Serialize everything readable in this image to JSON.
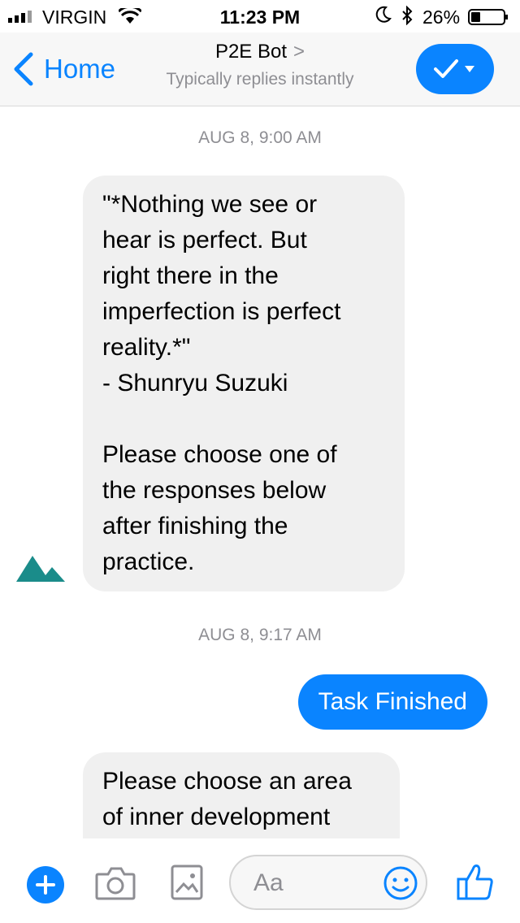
{
  "status_bar": {
    "carrier": "VIRGIN",
    "time": "11:23 PM",
    "battery": "26%"
  },
  "header": {
    "back_label": "Home",
    "title": "P2E Bot",
    "chevron": ">",
    "subtitle": "Typically replies instantly"
  },
  "messages": {
    "timestamp_1": "AUG 8, 9:00 AM",
    "bot_message_1_lines": [
      "\"*Nothing we see or",
      "hear is perfect. But",
      "right there in the",
      "imperfection is perfect",
      "reality.*\"",
      "- Shunryu Suzuki",
      "",
      "Please choose one of",
      "the responses below",
      "after finishing the",
      "practice."
    ],
    "timestamp_2": "AUG 8, 9:17 AM",
    "user_message_1": "Task Finished",
    "bot_message_2_lines": [
      "Please choose an area",
      "of inner development"
    ]
  },
  "composer": {
    "placeholder": "Aa"
  },
  "colors": {
    "accent": "#0a84ff",
    "bubble_in": "#f0f0f0",
    "avatar": "#1a8c8a"
  }
}
